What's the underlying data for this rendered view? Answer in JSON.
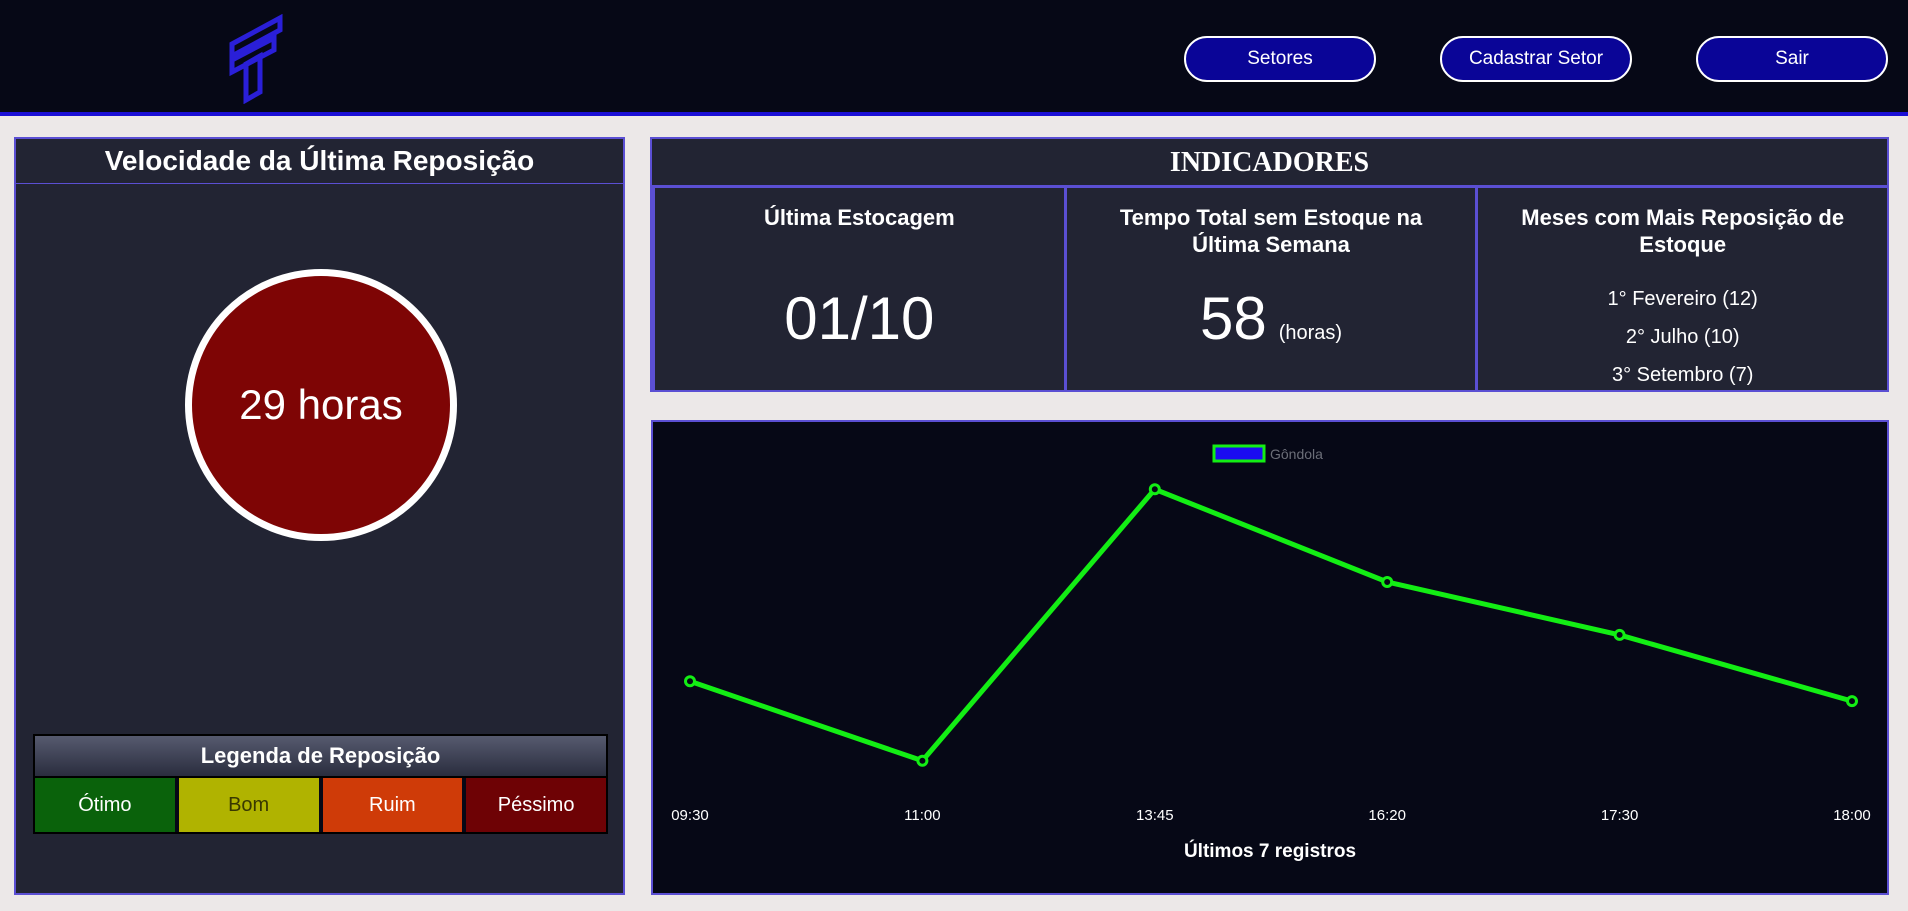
{
  "header": {
    "logo_icon": "t-logo-icon",
    "nav": {
      "setores_label": "Setores",
      "cadastrar_label": "Cadastrar Setor",
      "sair_label": "Sair"
    }
  },
  "left_panel": {
    "title": "Velocidade da Última Reposição",
    "speed_value": "29 horas",
    "speed_color": "#7e0505",
    "legend": {
      "title": "Legenda de Reposição",
      "items": [
        {
          "label": "Ótimo",
          "color": "#0a620b",
          "text_color": "#ffffff"
        },
        {
          "label": "Bom",
          "color": "#b0b300",
          "text_color": "#383800"
        },
        {
          "label": "Ruim",
          "color": "#cf3b08",
          "text_color": "#ffffff"
        },
        {
          "label": "Péssimo",
          "color": "#6e0205",
          "text_color": "#ffffff"
        }
      ]
    }
  },
  "indicators": {
    "title": "INDICADORES",
    "ultima_estocagem": {
      "label": "Última Estocagem",
      "value": "01/10"
    },
    "tempo_sem_estoque": {
      "label": "Tempo Total sem Estoque na Última Semana",
      "value": "58",
      "unit": "(horas)"
    },
    "meses_reposicao": {
      "label": "Meses com Mais Reposição de Estoque",
      "items": [
        "1° Fevereiro (12)",
        "2° Julho (10)",
        "3° Setembro (7)"
      ]
    }
  },
  "chart_data": {
    "type": "line",
    "categories": [
      "09:30",
      "11:00",
      "13:45",
      "16:20",
      "17:30",
      "18:00"
    ],
    "series": [
      {
        "name": "Gôndola",
        "values": [
          29,
          17,
          58,
          44,
          36,
          26
        ],
        "line_color": "#13ee14",
        "legend_fill": "#1a0cf2"
      }
    ],
    "xlabel": "Últimos 7 registros",
    "ylabel": "",
    "ylim": [
      15,
      60
    ],
    "grid": false,
    "legend_position": "top-center"
  },
  "colors": {
    "accent": "#5b4fd3",
    "header_bg": "#060816",
    "panel_bg": "#222433",
    "button_bg": "#0a0597"
  }
}
